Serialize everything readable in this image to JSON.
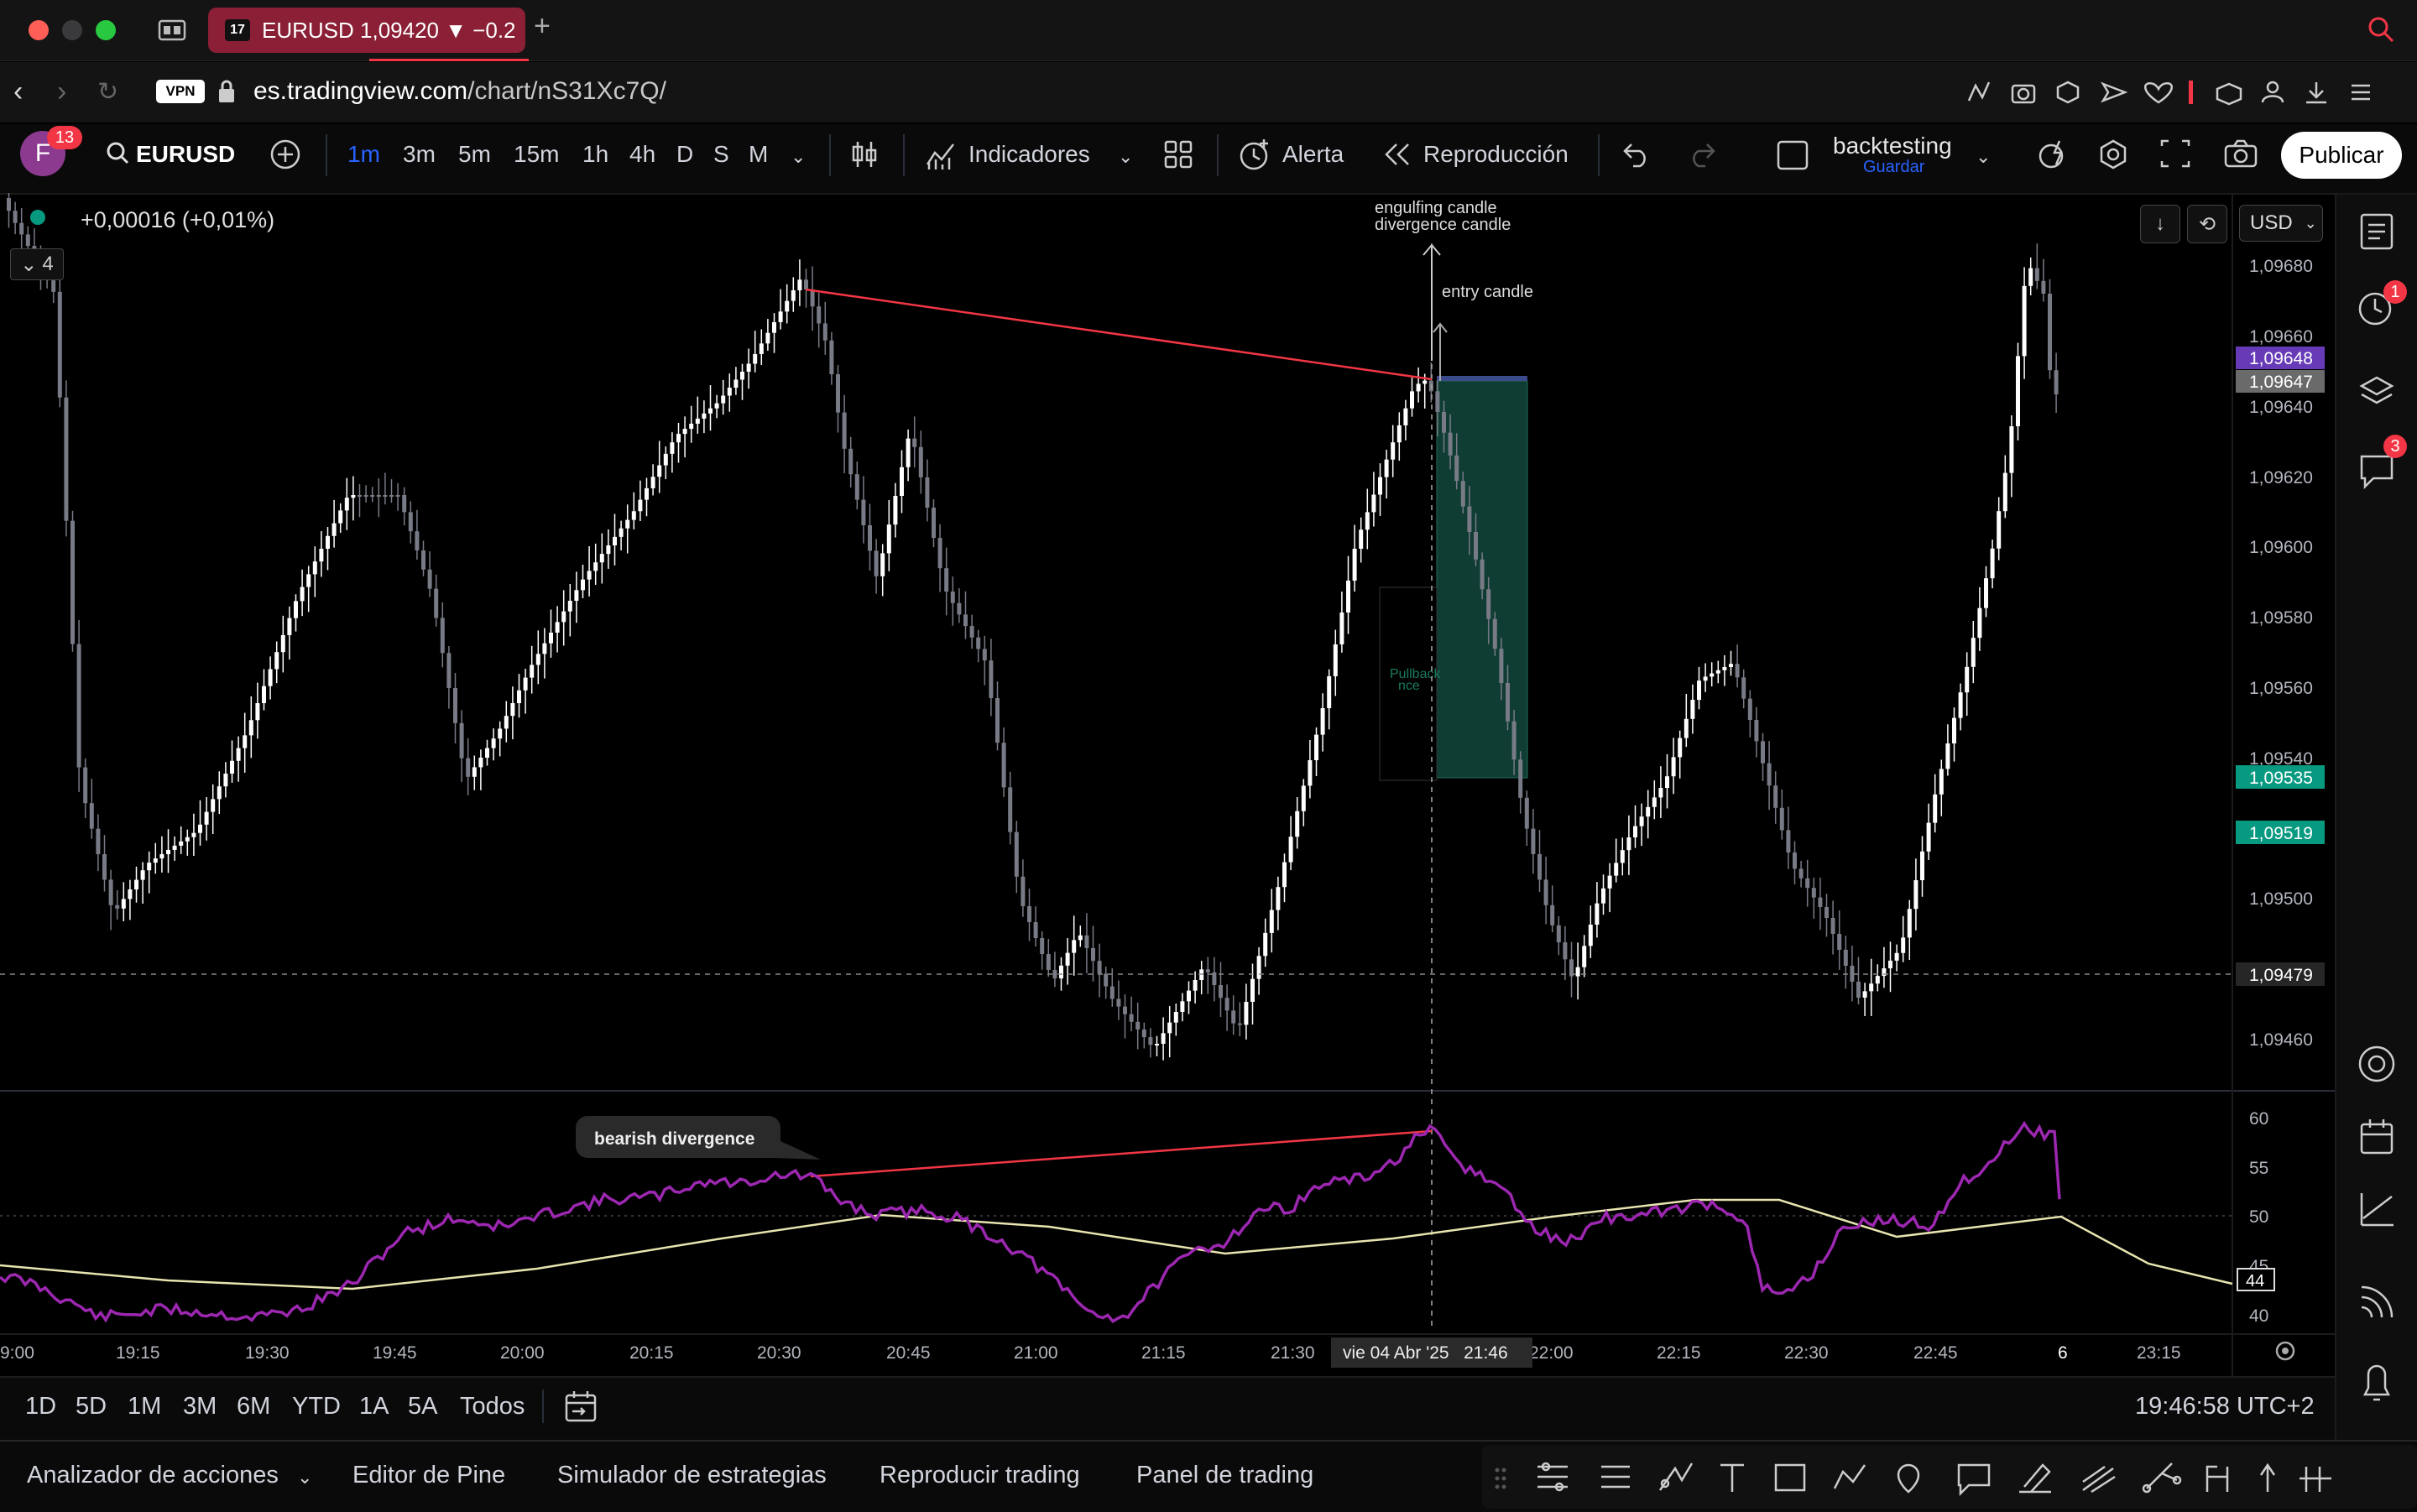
{
  "browser": {
    "tab_title": "EURUSD 1,09420 ▼ −0.2",
    "url_host": "es.tradingview.com",
    "url_path": "/chart/nS31Xc7Q/",
    "vpn_label": "VPN"
  },
  "header": {
    "avatar_letter": "F",
    "notification_count": "13",
    "symbol": "EURUSD",
    "timeframes": [
      "1m",
      "3m",
      "5m",
      "15m",
      "1h",
      "4h",
      "D",
      "S",
      "M"
    ],
    "active_timeframe": "1m",
    "indicators_label": "Indicadores",
    "alert_label": "Alerta",
    "replay_label": "Reproducción",
    "layout_name": "backtesting",
    "layout_save": "Guardar",
    "publish_label": "Publicar"
  },
  "chart": {
    "change_text": "+0,00016 (+0,01%)",
    "collapse_count": "4",
    "currency": "USD",
    "price_axis": [
      "1,09680",
      "1,09660",
      "1,09640",
      "1,09620",
      "1,09600",
      "1,09580",
      "1,09560",
      "1,09540",
      "1,09500",
      "1,09460"
    ],
    "price_tags": {
      "purple": "1,09648",
      "gray": "1,09647",
      "green1": "1,09535",
      "green2": "1,09519",
      "crosshair": "1,09479"
    },
    "annotations": {
      "engulfing": "engulfing candle",
      "divergence_candle": "divergence candle",
      "entry": "entry candle",
      "bearish": "bearish divergence"
    },
    "rsi_axis": [
      "60",
      "55",
      "50",
      "45",
      "40"
    ],
    "rsi_tag": "44",
    "time_axis": [
      "9:00",
      "19:15",
      "19:30",
      "19:45",
      "20:00",
      "20:15",
      "20:30",
      "20:45",
      "21:00",
      "21:15",
      "21:30",
      "22:00",
      "22:15",
      "22:30",
      "22:45",
      "6",
      "23:15"
    ],
    "crosshair_time": "vie 04 Abr '25   21:46",
    "colors": {
      "up_candle": "#ffffff",
      "down_candle": "#787b86",
      "rsi_line": "#9c27b0",
      "rsi_ma": "#e8e4b0",
      "trend_line": "#f23645",
      "short_zone": "#0f3d33"
    }
  },
  "range_bar": {
    "ranges": [
      "1D",
      "5D",
      "1M",
      "3M",
      "6M",
      "YTD",
      "1A",
      "5A",
      "Todos"
    ],
    "clock": "19:46:58 UTC+2"
  },
  "bottom_tabs": [
    "Analizador de acciones",
    "Editor de Pine",
    "Simulador de estrategias",
    "Reproducir trading",
    "Panel de trading"
  ],
  "sidebar_badges": {
    "alerts": "1",
    "chats": "3"
  }
}
